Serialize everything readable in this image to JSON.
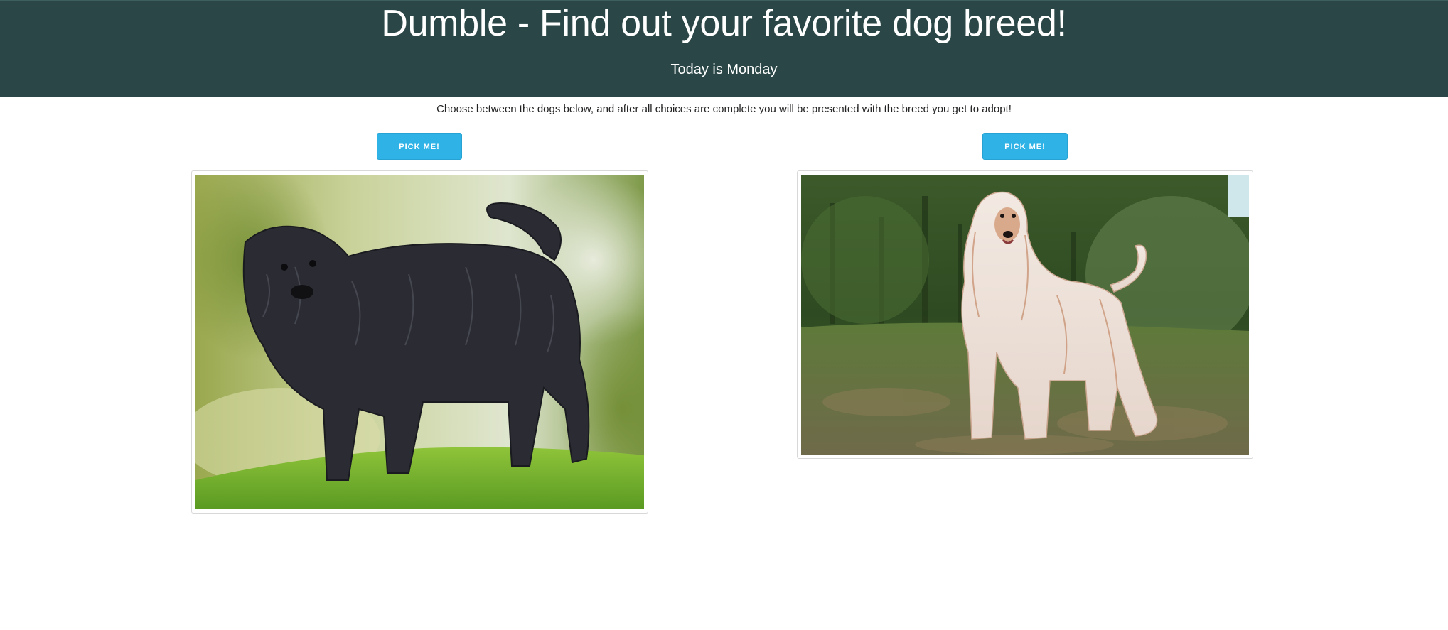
{
  "header": {
    "title": "Dumble - Find out your favorite dog breed!",
    "subtitle": "Today is Monday"
  },
  "instructions": "Choose between the dogs below, and after all choices are complete you will be presented with the breed you get to adopt!",
  "choices": [
    {
      "button_label": "PICK ME!",
      "image_icon": "black-shaggy-dog-photo"
    },
    {
      "button_label": "PICK ME!",
      "image_icon": "afghan-hound-photo"
    }
  ],
  "colors": {
    "header_bg": "#2a4646",
    "button_bg": "#2fb3e6"
  }
}
